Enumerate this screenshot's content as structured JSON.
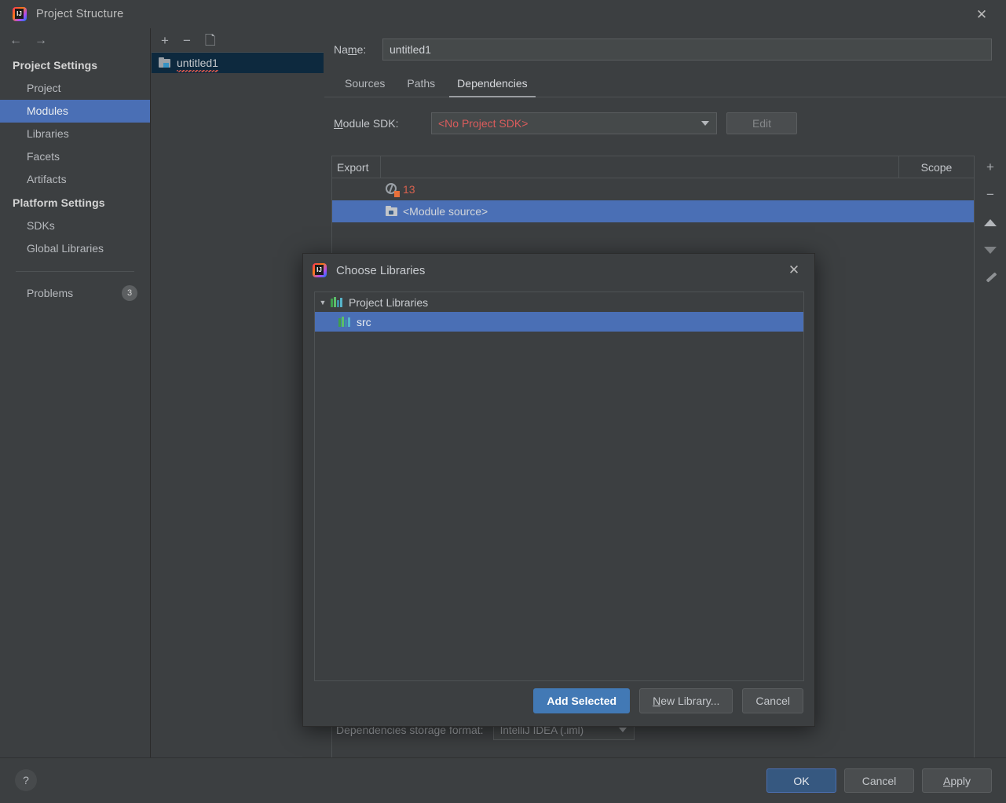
{
  "window": {
    "title": "Project Structure",
    "logo_icon": "intellij-logo-icon",
    "close_icon": "close-icon"
  },
  "nav": {
    "back_icon": "arrow-left-icon",
    "forward_icon": "arrow-right-icon"
  },
  "sidebar": {
    "groups": [
      {
        "title": "Project Settings",
        "items": [
          "Project",
          "Modules",
          "Libraries",
          "Facets",
          "Artifacts"
        ]
      },
      {
        "title": "Platform Settings",
        "items": [
          "SDKs",
          "Global Libraries"
        ]
      }
    ],
    "selected_item": "Modules",
    "problems": {
      "label": "Problems",
      "count": "3"
    }
  },
  "module_panel": {
    "toolbar": {
      "add": "+",
      "remove": "−",
      "copy_icon": "copy-icon"
    },
    "modules": [
      {
        "name": "untitled1",
        "icon": "module-folder-icon",
        "selected": true,
        "has_error": true
      }
    ]
  },
  "main": {
    "name_label": "Name:",
    "name_value": "untitled1",
    "tabs": [
      {
        "label": "Sources",
        "active": false
      },
      {
        "label": "Paths",
        "active": false
      },
      {
        "label": "Dependencies",
        "active": true
      }
    ],
    "sdk_label": "Module SDK:",
    "sdk_value": "<No Project SDK>",
    "edit_button": "Edit",
    "table": {
      "columns": [
        "Export",
        "",
        "Scope"
      ],
      "rows": [
        {
          "export": "",
          "icon": "sdk-globe-warning-icon",
          "name": "13",
          "scope": "",
          "selected": false,
          "error": true
        },
        {
          "export": "",
          "icon": "module-source-icon",
          "name": "<Module source>",
          "scope": "",
          "selected": true,
          "error": false
        }
      ]
    },
    "side_toolbar": {
      "add_icon": "plus-icon",
      "remove_icon": "minus-icon",
      "move_up_icon": "arrow-up-icon",
      "move_down_icon": "arrow-down-icon",
      "edit_icon": "pencil-icon"
    },
    "storage_label": "Dependencies storage format:",
    "storage_value": "IntelliJ IDEA (.iml)"
  },
  "modal": {
    "title": "Choose Libraries",
    "logo_icon": "intellij-logo-icon",
    "close_icon": "close-icon",
    "tree": [
      {
        "label": "Project Libraries",
        "level": 0,
        "expanded": true,
        "icon": "library-icon",
        "selected": false
      },
      {
        "label": "src",
        "level": 1,
        "expanded": false,
        "icon": "library-icon",
        "selected": true
      }
    ],
    "buttons": {
      "add_selected": "Add Selected",
      "new_library": "New Library...",
      "cancel": "Cancel"
    }
  },
  "bottom_bar": {
    "help_icon": "?",
    "ok": "OK",
    "cancel": "Cancel",
    "apply": "Apply"
  },
  "colors": {
    "background": "#3c3f41",
    "selection_blue": "#4a6fb5",
    "primary_button": "#4279b5",
    "error_red": "#db5c5c",
    "inactive_selection": "#0d293e"
  }
}
